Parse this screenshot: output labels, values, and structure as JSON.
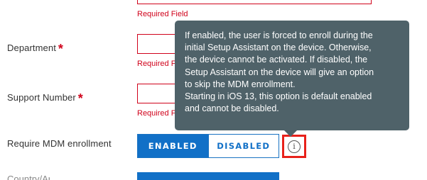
{
  "form": {
    "top_field": {
      "error": "Required Field"
    },
    "department": {
      "label": "Department",
      "required_marker": "*",
      "error": "Required F"
    },
    "support_number": {
      "label": "Support Number",
      "required_marker": "*",
      "error": "Required F"
    },
    "require_mdm": {
      "label": "Require MDM enrollment",
      "enabled_label": "ENABLED",
      "disabled_label": "DISABLED",
      "selected": "ENABLED",
      "info_icon_glyph": "i"
    },
    "next_row": {
      "label": "Country/Area"
    }
  },
  "tooltip": {
    "text": "If enabled, the user is forced to enroll during the\ninitial Setup Assistant on the device. Otherwise,\nthe device cannot be activated. If disabled, the\nSetup Assistant on the device will give an option\nto skip the MDM enrollment.\nStarting in iOS 13, this option is default enabled\nand cannot be disabled."
  },
  "colors": {
    "accent": "#1170c7",
    "error": "#d0021b",
    "tooltip_bg": "#4f6269",
    "highlight": "#e8211a"
  },
  "icons": {
    "info": "info-circle-icon"
  }
}
